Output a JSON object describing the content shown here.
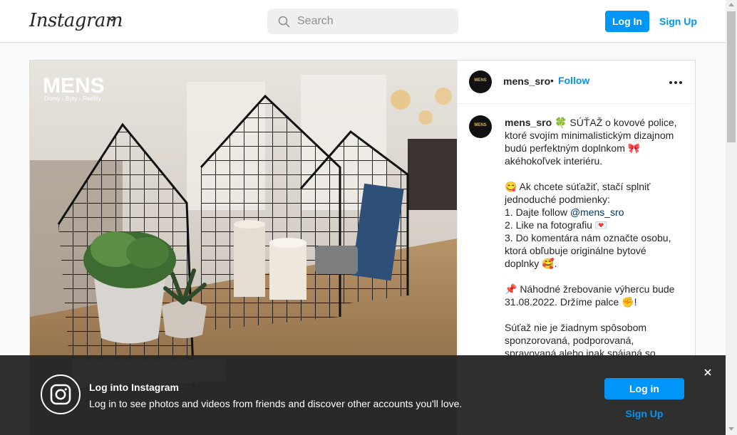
{
  "nav": {
    "logo_text": "Instagram",
    "search_placeholder": "Search",
    "login_label": "Log In",
    "signup_label": "Sign Up"
  },
  "post": {
    "photo_brand": "MENS",
    "photo_brand_sub": "Domy - Byty - Reality",
    "avatar_text": "MENS",
    "username": "mens_sro",
    "separator": "•",
    "follow_label": "Follow",
    "caption": {
      "username": "mens_sro",
      "p1": " 🍀 SÚŤAŽ o kovové police, ktoré svojím minimalistickým dizajnom budú perfektným doplnkom 🎀 akéhokoľvek interiéru.",
      "p2a": "😋 Ak chcete súťažiť, stačí splniť jednoduché podmienky:\n1. Dajte follow ",
      "mention": "@mens_sro",
      "p2b": "\n2. Like na fotografiu 💌\n3. Do komentára nám označte osobu, ktorá obľubuje originálne bytové doplnky 🥰.",
      "p3": "📌 Náhodné žrebovanie výhercu bude 31.08.2022. Držíme palce ✊!",
      "p4": "Súťaž nie je žiadnym spôsobom sponzorovaná, podporovaná, spravovaná alebo inak spájaná so"
    }
  },
  "banner": {
    "title": "Log into Instagram",
    "text": "Log in to see photos and videos from friends and discover other accounts you'll love.",
    "login_label": "Log in",
    "signup_label": "Sign Up"
  },
  "colors": {
    "accent": "#0095f6",
    "banner_bg": "#262626"
  },
  "icons": [
    "chevron-down-icon",
    "search-icon",
    "more-icon",
    "instagram-icon",
    "close-icon"
  ]
}
